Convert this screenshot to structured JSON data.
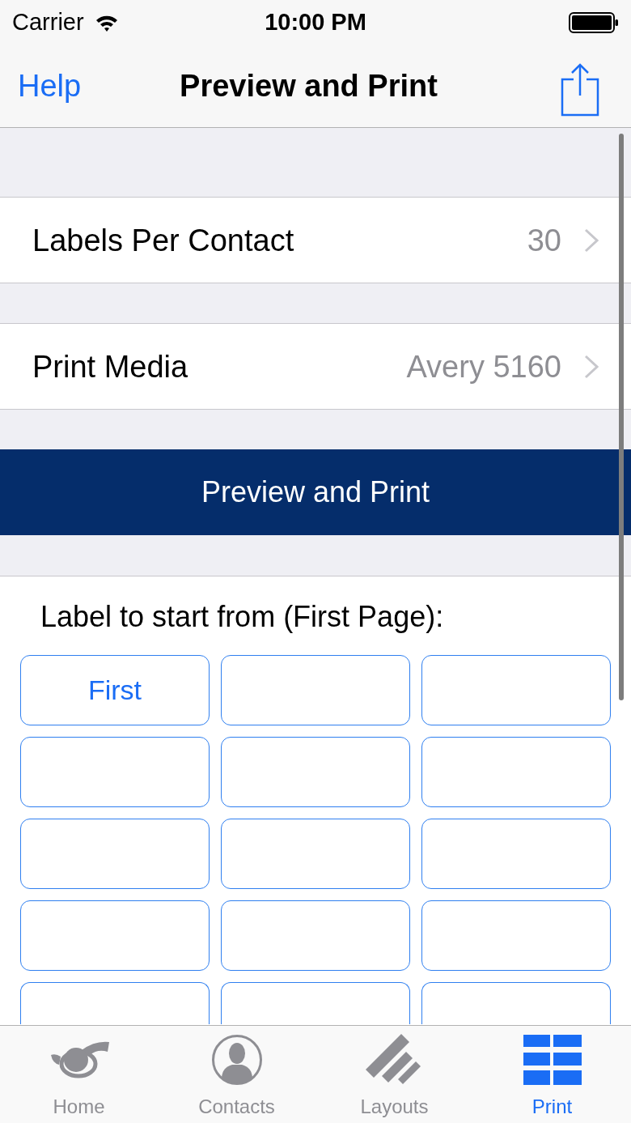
{
  "status_bar": {
    "carrier": "Carrier",
    "time": "10:00 PM"
  },
  "nav_bar": {
    "left_button": "Help",
    "title": "Preview and Print"
  },
  "settings": [
    {
      "label": "Labels Per Contact",
      "value": "30"
    },
    {
      "label": "Print Media",
      "value": "Avery 5160"
    }
  ],
  "primary_button": "Preview and Print",
  "start_label": {
    "heading": "Label to start from (First Page):",
    "cells": [
      {
        "label": "First"
      },
      {},
      {},
      {},
      {},
      {},
      {},
      {},
      {},
      {},
      {},
      {},
      {},
      {},
      {}
    ]
  },
  "tab_bar": [
    {
      "label": "Home",
      "kind": "home",
      "selected": false
    },
    {
      "label": "Contacts",
      "kind": "contacts",
      "selected": false
    },
    {
      "label": "Layouts",
      "kind": "layouts",
      "selected": false
    },
    {
      "label": "Print",
      "kind": "print",
      "selected": true
    }
  ]
}
